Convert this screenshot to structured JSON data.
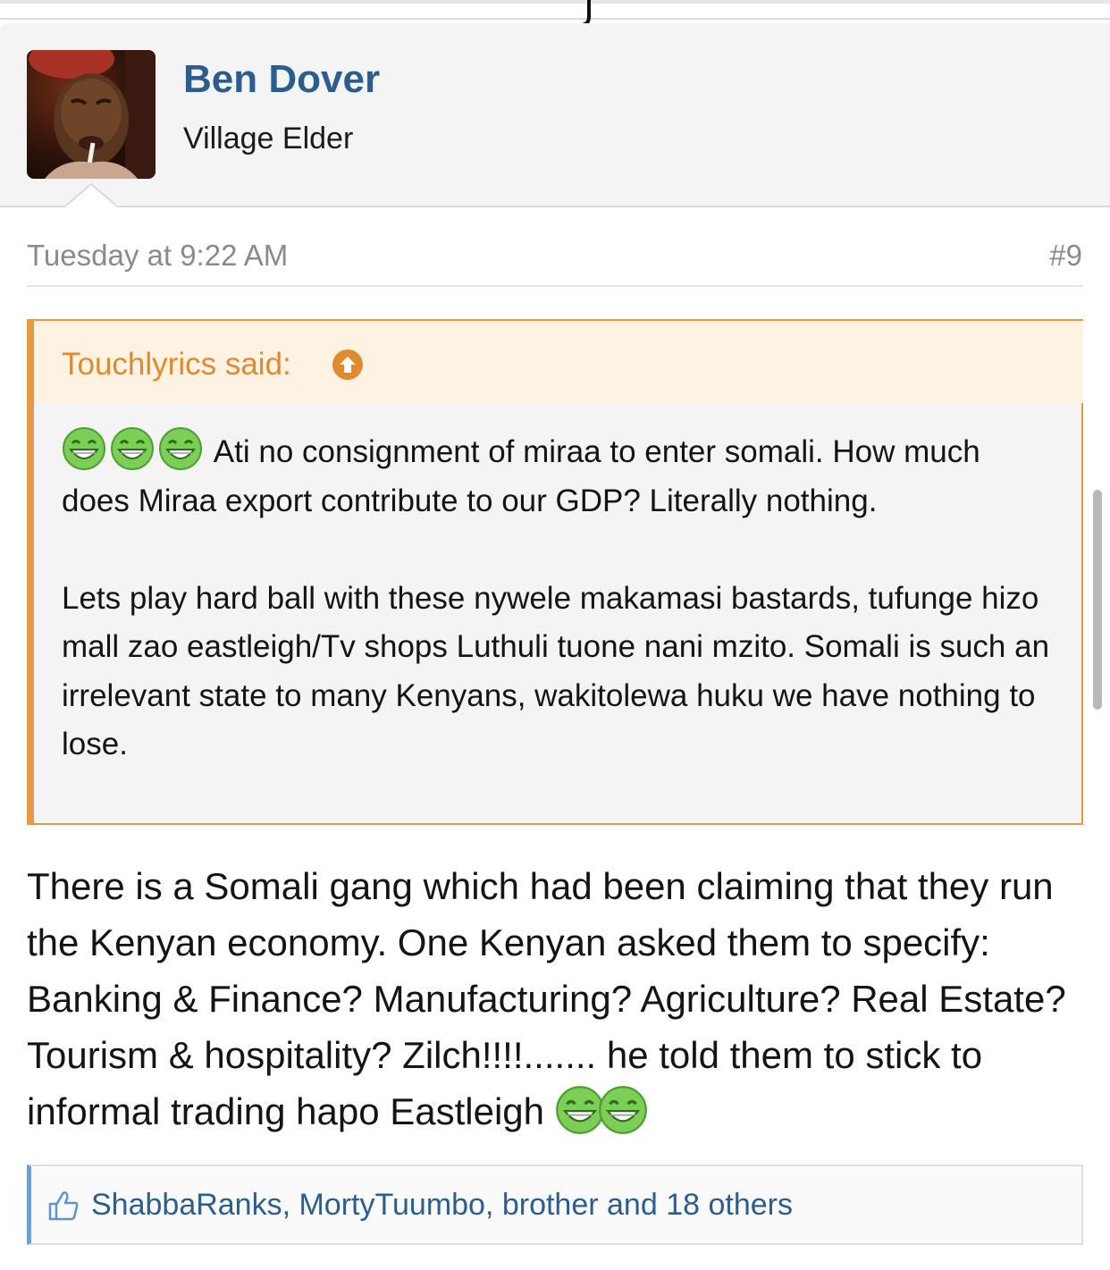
{
  "post": {
    "author": "Ben Dover",
    "user_title": "Village Elder",
    "date": "Tuesday at 9:22 AM",
    "number": "#9"
  },
  "quote": {
    "attribution": "Touchlyrics said:",
    "paragraph1": "Ati no consignment of miraa to enter somali. How much does Miraa export contribute to our GDP? Literally nothing.",
    "paragraph2": "Lets play hard ball with these nywele makamasi bastards, tufunge hizo mall zao eastleigh/Tv shops Luthuli tuone nani mzito. Somali is such an irrelevant state to many Kenyans, wakitolewa huku we have nothing to lose."
  },
  "message": {
    "text": "There is a Somali gang which had been claiming that they run the Kenyan economy. One Kenyan asked them to specify: Banking & Finance? Manufacturing? Agriculture? Real Estate? Tourism & hospitality? Zilch!!!!....... he told them to stick to informal trading hapo Eastleigh"
  },
  "likes": {
    "text": "ShabbaRanks, MortyTuumbo, brother and 18 others"
  },
  "icons": {
    "emoji": "grinning-face-icon",
    "quote_arrow": "arrow-up-circle-icon",
    "like": "thumbs-up-icon"
  },
  "colors": {
    "author_link": "#2b5d8f",
    "quote_accent": "#e29b44",
    "quote_header_bg": "#fef2e2",
    "likes_accent": "#6ba1d6",
    "emoji_green": "#6cc24a"
  }
}
